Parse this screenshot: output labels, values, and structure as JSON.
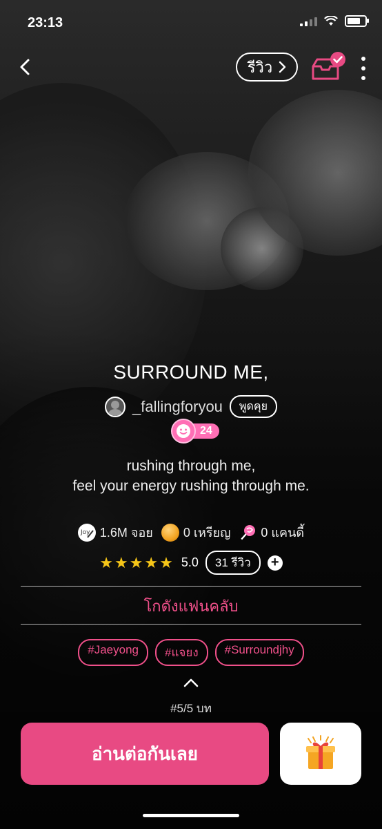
{
  "status_bar": {
    "time": "23:13"
  },
  "nav": {
    "review_label": "รีวิว"
  },
  "story": {
    "title": "SURROUND ME,",
    "author": "_fallingforyou",
    "chat_label": "พูดคุย",
    "level": "24",
    "description_line1": "rushing through me,",
    "description_line2": "feel your energy rushing through me."
  },
  "stats": {
    "views": "1.6M จอย",
    "coins": "0 เหรียญ",
    "candy": "0 แคนดี้"
  },
  "rating": {
    "stars": "★★★★★",
    "score": "5.0",
    "review_count": "31 รีวิว"
  },
  "fanclub_label": "โกดังแฟนคลับ",
  "tags": [
    "#Jaeyong",
    "#แจยง",
    "#Surroundjhy"
  ],
  "chapter_label": "#5/5 บท",
  "read_button_label": "อ่านต่อกันเลย",
  "colors": {
    "accent": "#e84a83",
    "star": "#f5c518",
    "level": "#ff6fb5"
  }
}
